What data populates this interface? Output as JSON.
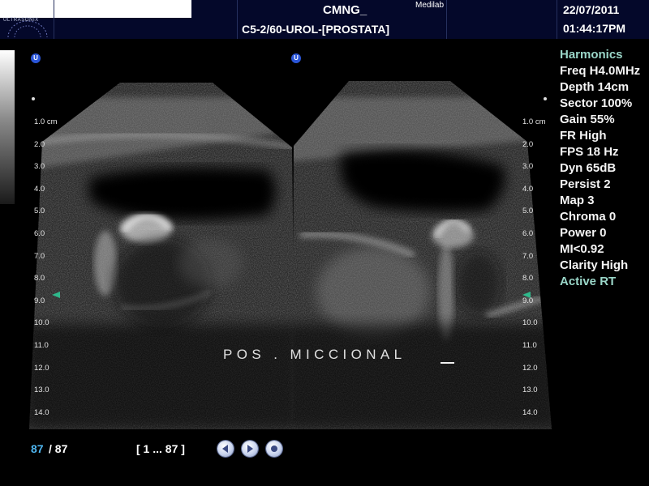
{
  "header": {
    "logo_text": "ULTRASONIX",
    "patient": "CMNG_",
    "facility": "Medilab",
    "exam": "C5-2/60-UROL-[PROSTATA]",
    "date": "22/07/2011",
    "time": "01:44:17PM"
  },
  "depth_scale": {
    "first_label": "1.0 cm",
    "labels": [
      "2.0",
      "3.0",
      "4.0",
      "5.0",
      "6.0",
      "7.0",
      "8.0",
      "9.0",
      "10.0",
      "11.0",
      "12.0",
      "13.0",
      "14.0"
    ]
  },
  "annotation": "POS . MICCIONAL",
  "params": [
    {
      "text": "Harmonics",
      "accent": true
    },
    {
      "text": "Freq H4.0MHz",
      "accent": false
    },
    {
      "text": "Depth 14cm",
      "accent": false
    },
    {
      "text": "Sector 100%",
      "accent": false
    },
    {
      "text": "Gain 55%",
      "accent": false
    },
    {
      "text": "FR High",
      "accent": false
    },
    {
      "text": "FPS 18 Hz",
      "accent": false
    },
    {
      "text": "Dyn 65dB",
      "accent": false
    },
    {
      "text": "Persist 2",
      "accent": false
    },
    {
      "text": "Map 3",
      "accent": false
    },
    {
      "text": "Chroma 0",
      "accent": false
    },
    {
      "text": "Power 0",
      "accent": false
    },
    {
      "text": "MI<0.92",
      "accent": false
    },
    {
      "text": "Clarity High",
      "accent": false
    },
    {
      "text": "Active RT",
      "accent": true
    }
  ],
  "footer": {
    "frame_current": "87",
    "frame_total": "/ 87",
    "frame_range": "[ 1 ... 87 ]"
  },
  "icons": {
    "probe_orientation": "u-orientation-icon",
    "controls": [
      "rewind-icon",
      "play-icon",
      "stop-icon"
    ]
  },
  "colors": {
    "header_bg": "#04082a",
    "accent_teal": "#9ad6c8",
    "frame_blue": "#4fb6f0",
    "marker_green": "#2fb88b"
  }
}
